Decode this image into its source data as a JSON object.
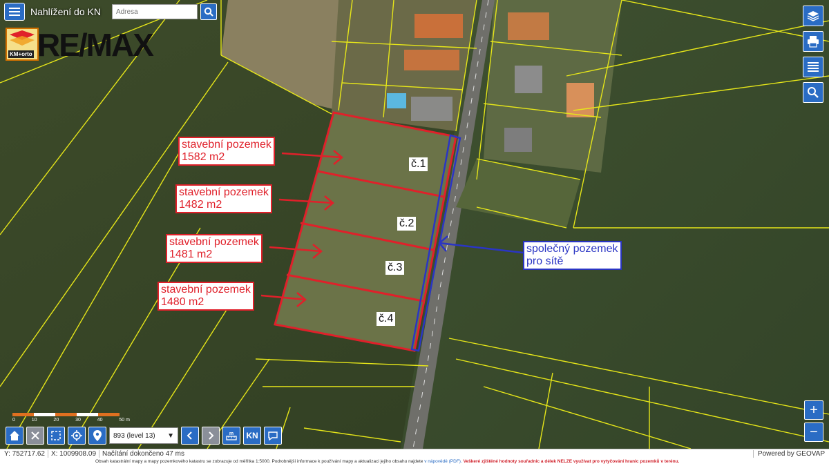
{
  "header": {
    "app_title": "Nahlížení do KN",
    "search_placeholder": "Adresa"
  },
  "logo": {
    "brand": "RE/MAX",
    "badge": "KM+orto"
  },
  "plots": [
    {
      "label_line1": "stavební pozemek",
      "label_line2": "1582 m2",
      "number": "č.1"
    },
    {
      "label_line1": "stavební pozemek",
      "label_line2": "1482 m2",
      "number": "č.2"
    },
    {
      "label_line1": "stavební pozemek",
      "label_line2": "1481 m2",
      "number": "č.3"
    },
    {
      "label_line1": "stavební pozemek",
      "label_line2": "1480 m2",
      "number": "č.4"
    }
  ],
  "shared_plot": {
    "line1": "společný pozemek",
    "line2": "pro sítě"
  },
  "scale": {
    "labels": [
      "0",
      "10",
      "20",
      "30",
      "40",
      "50 m"
    ]
  },
  "toolbar": {
    "level_select_value": "893 (level 13)",
    "kn_label": "KN"
  },
  "status": {
    "y_coord": "Y: 752717.62",
    "x_coord": "X: 1009908.09",
    "load_msg": "Načítání dokončeno 47 ms",
    "note_text": "Obsah katastrální mapy a mapy pozemkového katastru se zobrazuje od měřítka 1:5000. Podrobnější informace k používání mapy a aktualizaci jejího obsahu najdete",
    "note_link": "v nápovědě (PDF).",
    "note_warning": "Veškeré zjištěné hodnoty souřadnic a délek NELZE využívat pro vytyčování hranic pozemků v terénu.",
    "powered_by": "Powered by GEOVAP"
  },
  "colors": {
    "plot_border": "#e0202a",
    "shared_border": "#2a35c4",
    "parcel_lines": "#e6e619",
    "ui_blue": "#2a6cc4"
  }
}
